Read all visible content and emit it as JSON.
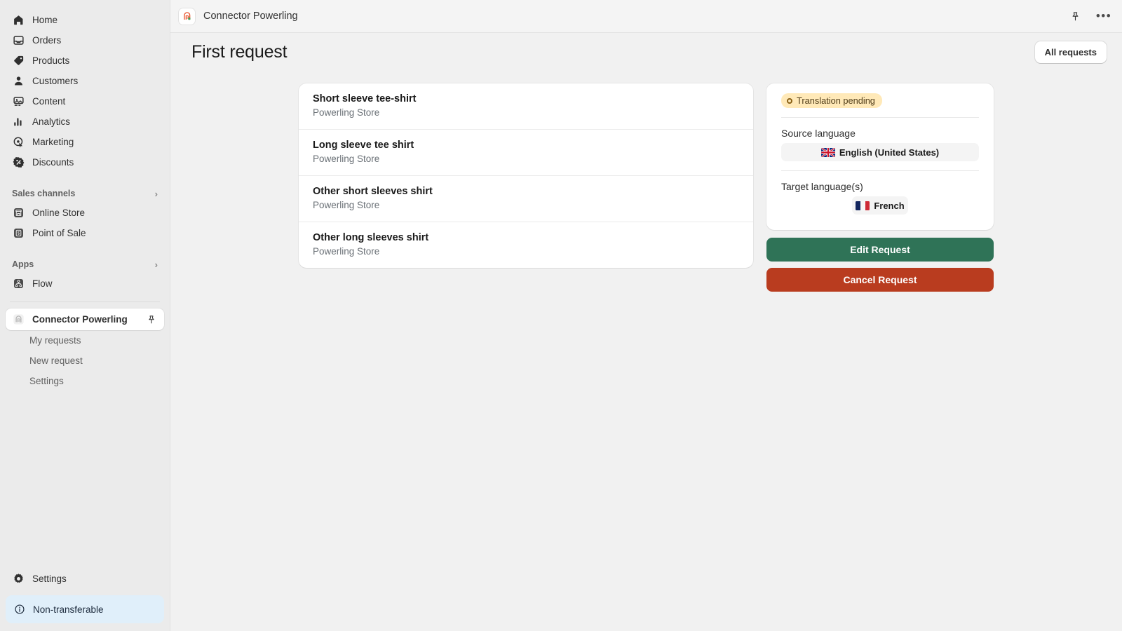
{
  "sidebar": {
    "primary": [
      {
        "label": "Home",
        "icon": "home-icon"
      },
      {
        "label": "Orders",
        "icon": "orders-icon"
      },
      {
        "label": "Products",
        "icon": "products-icon"
      },
      {
        "label": "Customers",
        "icon": "customers-icon"
      },
      {
        "label": "Content",
        "icon": "content-icon"
      },
      {
        "label": "Analytics",
        "icon": "analytics-icon"
      },
      {
        "label": "Marketing",
        "icon": "marketing-icon"
      },
      {
        "label": "Discounts",
        "icon": "discounts-icon"
      }
    ],
    "sales_channels": {
      "heading": "Sales channels",
      "chevron": "›",
      "items": [
        {
          "label": "Online Store",
          "icon": "store-icon"
        },
        {
          "label": "Point of Sale",
          "icon": "point-of-sale-icon"
        }
      ]
    },
    "apps": {
      "heading": "Apps",
      "chevron": "›",
      "items": [
        {
          "label": "Flow",
          "icon": "flow-icon"
        }
      ]
    },
    "active_app": {
      "label": "Connector Powerling",
      "icon": "powerling-app-icon",
      "pin_icon": "pin-icon"
    },
    "sub_items": [
      {
        "label": "My requests"
      },
      {
        "label": "New request"
      },
      {
        "label": "Settings"
      }
    ],
    "settings": {
      "label": "Settings",
      "icon": "gear-icon"
    },
    "notice": {
      "label": "Non-transferable",
      "icon": "info-icon"
    }
  },
  "topbar": {
    "app_title": "Connector Powerling",
    "app_icon": "powerling-app-icon",
    "pin_icon": "pin-icon",
    "more_icon": "•••"
  },
  "page": {
    "title": "First request",
    "all_requests_label": "All requests"
  },
  "products": [
    {
      "title": "Short sleeve tee-shirt",
      "store": "Powerling Store"
    },
    {
      "title": "Long sleeve tee shirt",
      "store": "Powerling Store"
    },
    {
      "title": "Other short sleeves shirt",
      "store": "Powerling Store"
    },
    {
      "title": "Other long sleeves shirt",
      "store": "Powerling Store"
    }
  ],
  "info": {
    "status_badge": "Translation pending",
    "source_label": "Source language",
    "source_language": "English (United States)",
    "source_flag": "flag-uk",
    "target_label": "Target language(s)",
    "target_language": "French",
    "target_flag": "flag-fr"
  },
  "actions": {
    "edit_label": "Edit Request",
    "cancel_label": "Cancel Request"
  },
  "colors": {
    "edit_button": "#2f7357",
    "cancel_button": "#b93c1f",
    "badge_bg": "#ffe9b8",
    "notice_bg": "#e0effa",
    "sidebar_bg": "#ebebeb",
    "content_bg": "#f1f1f1"
  }
}
